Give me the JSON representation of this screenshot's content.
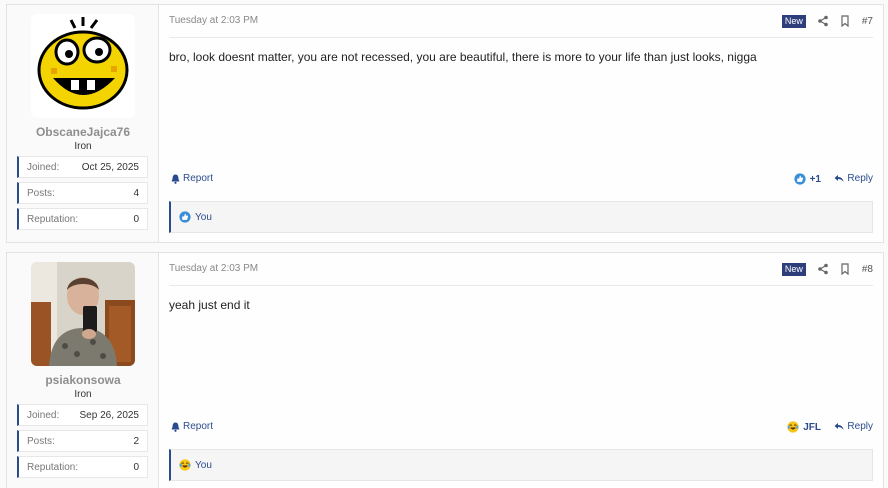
{
  "posts": [
    {
      "username": "ObscaneJajca76",
      "rank": "Iron",
      "stats": [
        {
          "label": "Joined:",
          "value": "Oct 25, 2025"
        },
        {
          "label": "Posts:",
          "value": "4"
        },
        {
          "label": "Reputation:",
          "value": "0"
        }
      ],
      "date": "Tuesday at 2:03 PM",
      "badge": "New",
      "post_number": "#7",
      "content": "bro, look doesnt matter, you are not recessed, you are beautiful, there is more to your life than just looks, nigga",
      "report_label": "Report",
      "reaction_label": "+1",
      "reply_label": "Reply",
      "reactors": "You"
    },
    {
      "username": "psiakonsowa",
      "rank": "Iron",
      "stats": [
        {
          "label": "Joined:",
          "value": "Sep 26, 2025"
        },
        {
          "label": "Posts:",
          "value": "2"
        },
        {
          "label": "Reputation:",
          "value": "0"
        }
      ],
      "date": "Tuesday at 2:03 PM",
      "badge": "New",
      "post_number": "#8",
      "content": "yeah just end it",
      "report_label": "Report",
      "reaction_label": "JFL",
      "reply_label": "Reply",
      "reactors": "You"
    }
  ],
  "icons": {
    "share": "share-icon",
    "bookmark": "bookmark-icon",
    "report": "bell-icon",
    "reply": "reply-arrow-icon",
    "like": "like-emoji-icon",
    "jfl": "crying-laughing-emoji-icon"
  },
  "colors": {
    "accent": "#2b4c8c",
    "badge_bg": "#2d3e7a",
    "username": "#8e8e8e"
  }
}
